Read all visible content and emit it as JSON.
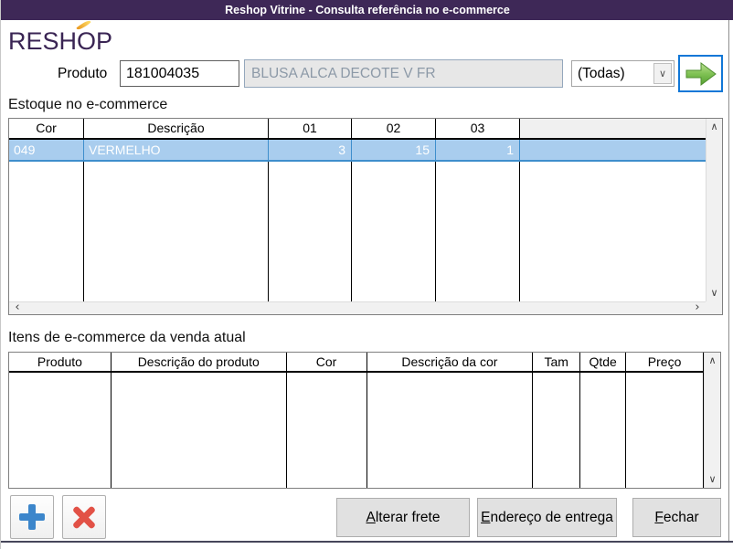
{
  "window": {
    "title": "Reshop Vitrine - Consulta referência no e-commerce"
  },
  "logo": {
    "text": "RESHOP"
  },
  "form": {
    "produto_label": "Produto",
    "produto_value": "181004035",
    "descricao_value": "BLUSA ALCA DECOTE V FR",
    "filtro_value": "(Todas)"
  },
  "estoque": {
    "section_title": "Estoque no e-commerce",
    "columns": [
      "Cor",
      "Descrição",
      "01",
      "02",
      "03",
      ""
    ],
    "rows": [
      {
        "cor": "049",
        "descricao": "VERMELHO",
        "c01": "3",
        "c02": "15",
        "c03": "1"
      }
    ]
  },
  "itens": {
    "section_title": "Itens de e-commerce da venda atual",
    "columns": [
      "Produto",
      "Descrição do produto",
      "Cor",
      "Descrição da cor",
      "Tam",
      "Qtde",
      "Preço"
    ]
  },
  "actions": {
    "alterar_frete": {
      "first": "A",
      "rest": "lterar frete"
    },
    "endereco_entrega": {
      "first": "E",
      "rest": "ndereço de entrega"
    },
    "fechar": {
      "first": "F",
      "rest": "echar"
    }
  },
  "icons": {
    "dropdown": "∨",
    "scroll_up": "∧",
    "scroll_down": "∨",
    "scroll_left": "‹",
    "scroll_right": "›"
  },
  "colors": {
    "titlebar_purple": "#3E2857",
    "logo_purple": "#3A2554",
    "flame_gold": "#F2A71B",
    "accent_blue_border": "#1177D7",
    "selection_bg": "#A9CDEE",
    "selection_border": "#3E8ECC",
    "arrow_green": "#5BA43C",
    "plus_blue": "#3C86CB",
    "x_red": "#E25146",
    "disabled_field_bg": "#E7E7E7",
    "disabled_field_text": "#8C99A7"
  }
}
